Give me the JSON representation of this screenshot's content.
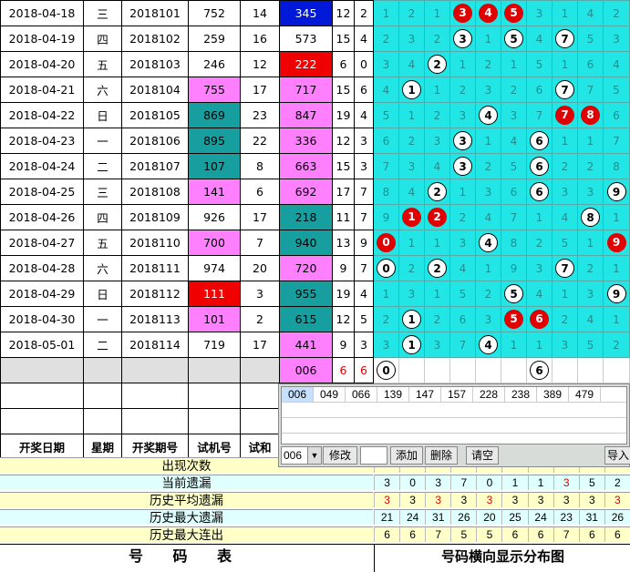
{
  "rows": [
    {
      "date": "2018-04-18",
      "weekday": "三",
      "issue": "2018101",
      "trial": "752",
      "sum": "14",
      "kaijiang": "345",
      "span": "12",
      "odd": "2",
      "grid": [
        [
          "1",
          "n"
        ],
        [
          "2",
          "n"
        ],
        [
          "1",
          "n"
        ],
        [
          "3",
          "r"
        ],
        [
          "4",
          "r"
        ],
        [
          "5",
          "r"
        ],
        [
          "3",
          "n"
        ],
        [
          "1",
          "n"
        ],
        [
          "4",
          "n"
        ],
        [
          "2",
          "n"
        ]
      ]
    },
    {
      "date": "2018-04-19",
      "weekday": "四",
      "issue": "2018102",
      "trial": "259",
      "sum": "16",
      "kaijiang": "573",
      "span": "15",
      "odd": "4",
      "grid": [
        [
          "2",
          "n"
        ],
        [
          "3",
          "n"
        ],
        [
          "2",
          "n"
        ],
        [
          "3",
          "w"
        ],
        [
          "1",
          "n"
        ],
        [
          "5",
          "w"
        ],
        [
          "4",
          "n"
        ],
        [
          "7",
          "w"
        ],
        [
          "5",
          "n"
        ],
        [
          "3",
          "n"
        ]
      ]
    },
    {
      "date": "2018-04-20",
      "weekday": "五",
      "issue": "2018103",
      "trial": "246",
      "sum": "12",
      "kaijiang": "222",
      "span": "6",
      "odd": "0",
      "grid": [
        [
          "3",
          "n"
        ],
        [
          "4",
          "n"
        ],
        [
          "2",
          "w"
        ],
        [
          "1",
          "n"
        ],
        [
          "2",
          "n"
        ],
        [
          "1",
          "n"
        ],
        [
          "5",
          "n"
        ],
        [
          "1",
          "n"
        ],
        [
          "6",
          "n"
        ],
        [
          "4",
          "n"
        ]
      ]
    },
    {
      "date": "2018-04-21",
      "weekday": "六",
      "issue": "2018104",
      "trial": "755",
      "sum": "17",
      "kaijiang": "717",
      "span": "15",
      "odd": "6",
      "grid": [
        [
          "4",
          "n"
        ],
        [
          "1",
          "w"
        ],
        [
          "1",
          "n"
        ],
        [
          "2",
          "n"
        ],
        [
          "3",
          "n"
        ],
        [
          "2",
          "n"
        ],
        [
          "6",
          "n"
        ],
        [
          "7",
          "w"
        ],
        [
          "7",
          "n"
        ],
        [
          "5",
          "n"
        ]
      ]
    },
    {
      "date": "2018-04-22",
      "weekday": "日",
      "issue": "2018105",
      "trial": "869",
      "sum": "23",
      "kaijiang": "847",
      "span": "19",
      "odd": "4",
      "grid": [
        [
          "5",
          "n"
        ],
        [
          "1",
          "n"
        ],
        [
          "2",
          "n"
        ],
        [
          "3",
          "n"
        ],
        [
          "4",
          "w"
        ],
        [
          "3",
          "n"
        ],
        [
          "7",
          "n"
        ],
        [
          "7",
          "r"
        ],
        [
          "8",
          "r"
        ],
        [
          "6",
          "n"
        ]
      ]
    },
    {
      "date": "2018-04-23",
      "weekday": "一",
      "issue": "2018106",
      "trial": "895",
      "sum": "22",
      "kaijiang": "336",
      "span": "12",
      "odd": "3",
      "grid": [
        [
          "6",
          "n"
        ],
        [
          "2",
          "n"
        ],
        [
          "3",
          "n"
        ],
        [
          "3",
          "w"
        ],
        [
          "1",
          "n"
        ],
        [
          "4",
          "n"
        ],
        [
          "6",
          "w"
        ],
        [
          "1",
          "n"
        ],
        [
          "1",
          "n"
        ],
        [
          "7",
          "n"
        ]
      ]
    },
    {
      "date": "2018-04-24",
      "weekday": "二",
      "issue": "2018107",
      "trial": "107",
      "sum": "8",
      "kaijiang": "663",
      "span": "15",
      "odd": "3",
      "grid": [
        [
          "7",
          "n"
        ],
        [
          "3",
          "n"
        ],
        [
          "4",
          "n"
        ],
        [
          "3",
          "w"
        ],
        [
          "2",
          "n"
        ],
        [
          "5",
          "n"
        ],
        [
          "6",
          "w"
        ],
        [
          "2",
          "n"
        ],
        [
          "2",
          "n"
        ],
        [
          "8",
          "n"
        ]
      ]
    },
    {
      "date": "2018-04-25",
      "weekday": "三",
      "issue": "2018108",
      "trial": "141",
      "sum": "6",
      "kaijiang": "692",
      "span": "17",
      "odd": "7",
      "grid": [
        [
          "8",
          "n"
        ],
        [
          "4",
          "n"
        ],
        [
          "2",
          "w"
        ],
        [
          "1",
          "n"
        ],
        [
          "3",
          "n"
        ],
        [
          "6",
          "n"
        ],
        [
          "6",
          "w"
        ],
        [
          "3",
          "n"
        ],
        [
          "3",
          "n"
        ],
        [
          "9",
          "w"
        ]
      ]
    },
    {
      "date": "2018-04-26",
      "weekday": "四",
      "issue": "2018109",
      "trial": "926",
      "sum": "17",
      "kaijiang": "218",
      "span": "11",
      "odd": "7",
      "grid": [
        [
          "9",
          "n"
        ],
        [
          "1",
          "r"
        ],
        [
          "2",
          "r"
        ],
        [
          "2",
          "n"
        ],
        [
          "4",
          "n"
        ],
        [
          "7",
          "n"
        ],
        [
          "1",
          "n"
        ],
        [
          "4",
          "n"
        ],
        [
          "8",
          "w"
        ],
        [
          "1",
          "n"
        ]
      ]
    },
    {
      "date": "2018-04-27",
      "weekday": "五",
      "issue": "2018110",
      "trial": "700",
      "sum": "7",
      "kaijiang": "940",
      "span": "13",
      "odd": "9",
      "grid": [
        [
          "0",
          "r"
        ],
        [
          "1",
          "n"
        ],
        [
          "1",
          "n"
        ],
        [
          "3",
          "n"
        ],
        [
          "4",
          "w"
        ],
        [
          "8",
          "n"
        ],
        [
          "2",
          "n"
        ],
        [
          "5",
          "n"
        ],
        [
          "1",
          "n"
        ],
        [
          "9",
          "r"
        ]
      ]
    },
    {
      "date": "2018-04-28",
      "weekday": "六",
      "issue": "2018111",
      "trial": "974",
      "sum": "20",
      "kaijiang": "720",
      "span": "9",
      "odd": "7",
      "grid": [
        [
          "0",
          "w"
        ],
        [
          "2",
          "n"
        ],
        [
          "2",
          "w"
        ],
        [
          "4",
          "n"
        ],
        [
          "1",
          "n"
        ],
        [
          "9",
          "n"
        ],
        [
          "3",
          "n"
        ],
        [
          "7",
          "w"
        ],
        [
          "2",
          "n"
        ],
        [
          "1",
          "n"
        ]
      ]
    },
    {
      "date": "2018-04-29",
      "weekday": "日",
      "issue": "2018112",
      "trial": "111",
      "sum": "3",
      "kaijiang": "955",
      "span": "19",
      "odd": "4",
      "grid": [
        [
          "1",
          "n"
        ],
        [
          "3",
          "n"
        ],
        [
          "1",
          "n"
        ],
        [
          "5",
          "n"
        ],
        [
          "2",
          "n"
        ],
        [
          "5",
          "w"
        ],
        [
          "4",
          "n"
        ],
        [
          "1",
          "n"
        ],
        [
          "3",
          "n"
        ],
        [
          "9",
          "w"
        ]
      ]
    },
    {
      "date": "2018-04-30",
      "weekday": "一",
      "issue": "2018113",
      "trial": "101",
      "sum": "2",
      "kaijiang": "615",
      "span": "12",
      "odd": "5",
      "grid": [
        [
          "2",
          "n"
        ],
        [
          "1",
          "w"
        ],
        [
          "2",
          "n"
        ],
        [
          "6",
          "n"
        ],
        [
          "3",
          "n"
        ],
        [
          "5",
          "r"
        ],
        [
          "6",
          "r"
        ],
        [
          "2",
          "n"
        ],
        [
          "4",
          "n"
        ],
        [
          "1",
          "n"
        ]
      ]
    },
    {
      "date": "2018-05-01",
      "weekday": "二",
      "issue": "2018114",
      "trial": "719",
      "sum": "17",
      "kaijiang": "441",
      "span": "9",
      "odd": "3",
      "grid": [
        [
          "3",
          "n"
        ],
        [
          "1",
          "w"
        ],
        [
          "3",
          "n"
        ],
        [
          "7",
          "n"
        ],
        [
          "4",
          "w"
        ],
        [
          "1",
          "n"
        ],
        [
          "1",
          "n"
        ],
        [
          "3",
          "n"
        ],
        [
          "5",
          "n"
        ],
        [
          "2",
          "n"
        ]
      ]
    }
  ],
  "prediction": {
    "kaijiang": "006",
    "span": "6",
    "odd": "6",
    "grid": [
      [
        "0",
        "w"
      ],
      [
        "",
        ""
      ],
      [
        "",
        ""
      ],
      [
        "",
        ""
      ],
      [
        "",
        ""
      ],
      [
        "",
        ""
      ],
      [
        "6",
        "w"
      ],
      [
        "",
        ""
      ],
      [
        "",
        ""
      ],
      [
        "",
        ""
      ]
    ]
  },
  "header": {
    "date": "开奖日期",
    "weekday": "星期",
    "issue": "开奖期号",
    "trial": "试机号",
    "sum": "试和"
  },
  "stats": [
    {
      "label": "出现次数",
      "values": [
        "",
        "",
        "",
        "",
        "",
        "",
        "",
        "",
        "",
        ""
      ]
    },
    {
      "label": "当前遗漏",
      "values": [
        "3",
        "0",
        "3",
        "7",
        "0",
        "1",
        "1",
        "3",
        "5",
        "2"
      ]
    },
    {
      "label": "历史平均遗漏",
      "values": [
        "3",
        "3",
        "3",
        "3",
        "3",
        "3",
        "3",
        "3",
        "3",
        "3"
      ]
    },
    {
      "label": "历史最大遗漏",
      "values": [
        "21",
        "24",
        "31",
        "26",
        "20",
        "25",
        "24",
        "23",
        "31",
        "26"
      ]
    },
    {
      "label": "历史最大连出",
      "values": [
        "6",
        "6",
        "7",
        "5",
        "5",
        "6",
        "6",
        "7",
        "6",
        "6"
      ]
    }
  ],
  "footer": {
    "left": "号 码 表",
    "right": "号码横向显示分布图"
  },
  "panel": {
    "list": [
      "006",
      "049",
      "066",
      "139",
      "147",
      "157",
      "228",
      "238",
      "389",
      "479"
    ],
    "select_value": "006",
    "edit_btn": "修改",
    "add_btn": "添加",
    "del_btn": "删除",
    "clear_btn": "请空",
    "import_btn": "导入"
  },
  "colors": {
    "cyan": "#22e6e6",
    "red": "#e10000",
    "pink": "#ff80ff",
    "teal": "#179f9f",
    "blue": "#0018d8"
  }
}
